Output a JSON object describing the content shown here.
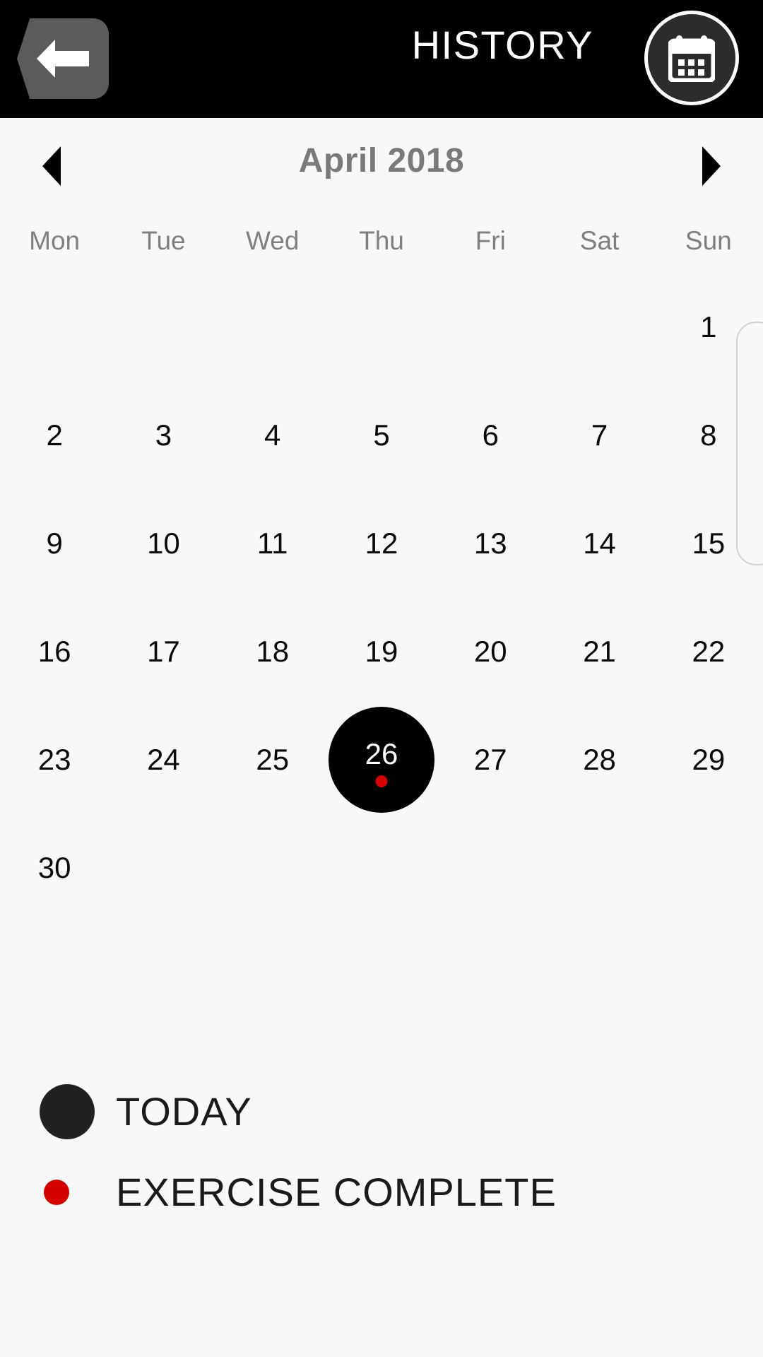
{
  "header": {
    "title": "HISTORY",
    "back_icon": "back-arrow-icon",
    "calendar_icon": "calendar-icon"
  },
  "month_nav": {
    "prev_icon": "chevron-left-icon",
    "next_icon": "chevron-right-icon",
    "label": "April 2018"
  },
  "calendar": {
    "weekdays": [
      "Mon",
      "Tue",
      "Wed",
      "Thu",
      "Fri",
      "Sat",
      "Sun"
    ],
    "weeks": [
      [
        "",
        "",
        "",
        "",
        "",
        "",
        "1"
      ],
      [
        "2",
        "3",
        "4",
        "5",
        "6",
        "7",
        "8"
      ],
      [
        "9",
        "10",
        "11",
        "12",
        "13",
        "14",
        "15"
      ],
      [
        "16",
        "17",
        "18",
        "19",
        "20",
        "21",
        "22"
      ],
      [
        "23",
        "24",
        "25",
        "26",
        "27",
        "28",
        "29"
      ],
      [
        "30",
        "",
        "",
        "",
        "",
        "",
        ""
      ]
    ],
    "today": "26",
    "exercise_complete_days": [
      "26"
    ]
  },
  "legend": {
    "items": [
      {
        "label": "TODAY",
        "marker": "today-dot",
        "color": "#212121"
      },
      {
        "label": "EXERCISE COMPLETE",
        "marker": "exercise-dot",
        "color": "#D40000"
      }
    ]
  },
  "colors": {
    "header_bg": "#000000",
    "page_bg": "#F8F8F8",
    "accent_red": "#D40000",
    "today_circle": "#000000",
    "muted_text": "#7F7F7F"
  }
}
